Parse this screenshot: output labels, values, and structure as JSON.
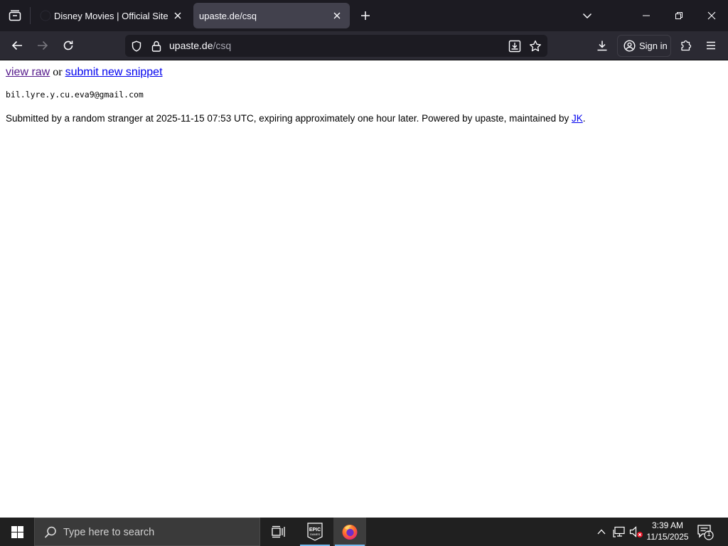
{
  "browser": {
    "tabs": [
      {
        "title": "Disney Movies | Official Site",
        "active": false
      },
      {
        "title": "upaste.de/csq",
        "active": true
      }
    ],
    "url": {
      "domain": "upaste.de",
      "path": "/csq"
    },
    "sign_in_label": "Sign in"
  },
  "page": {
    "view_raw_label": "view raw",
    "or_text": "or",
    "submit_label": "submit new snippet",
    "snippet_text": "bil.lyre.y.cu.eva9@gmail.com",
    "footer_text": "Submitted by a random stranger at 2025-11-15 07:53 UTC, expiring approximately one hour later. Powered by upaste, maintained by",
    "footer_link": "JK",
    "footer_end": "."
  },
  "taskbar": {
    "search_placeholder": "Type here to search",
    "time": "3:39 AM",
    "date": "11/15/2025",
    "notification_count": "1",
    "apps": [
      "task-view",
      "epic-games",
      "firefox"
    ]
  },
  "colors": {
    "tabstrip": "#1c1b22",
    "toolbar": "#2b2a33",
    "active_tab": "#42414d",
    "link": "#0000ee",
    "visited_link": "#551a8b",
    "taskbar": "#202020"
  }
}
